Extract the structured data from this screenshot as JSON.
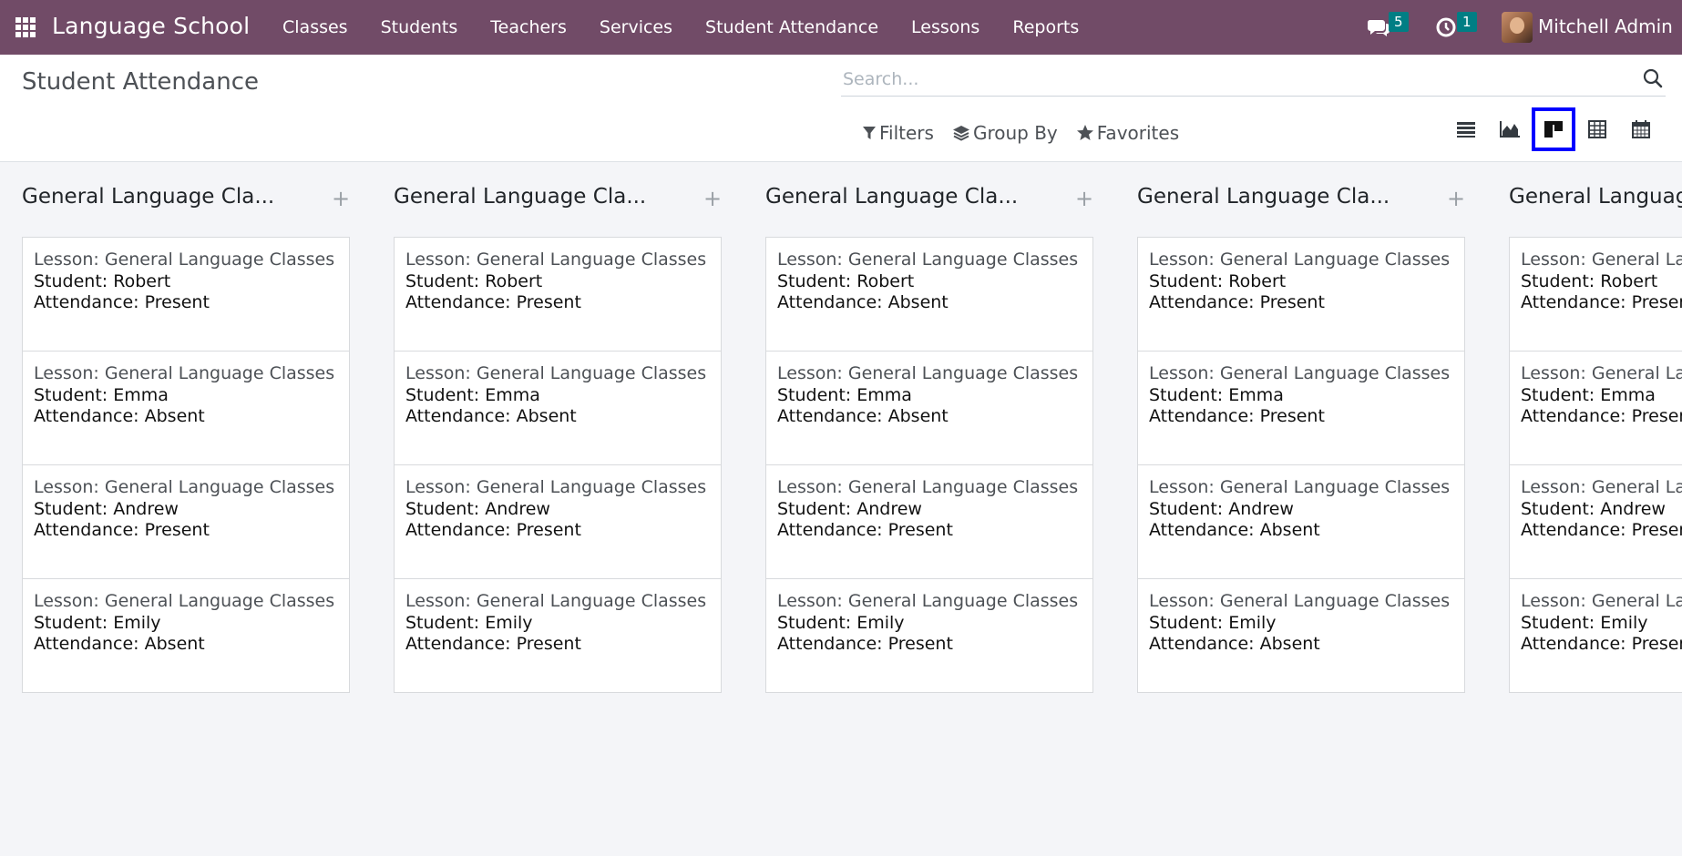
{
  "navbar": {
    "brand": "Language School",
    "menu": [
      "Classes",
      "Students",
      "Teachers",
      "Services",
      "Student Attendance",
      "Lessons",
      "Reports"
    ],
    "messages_count": "5",
    "activities_count": "1",
    "user": "Mitchell Admin"
  },
  "control_panel": {
    "title": "Student Attendance",
    "search_placeholder": "Search...",
    "filters_label": "Filters",
    "group_by_label": "Group By",
    "favorites_label": "Favorites",
    "views": [
      "list-view",
      "graph-view",
      "kanban-view",
      "pivot-view",
      "calendar-view"
    ],
    "active_view": "kanban-view"
  },
  "kanban": {
    "columns": [
      {
        "title": "General Language Cla...",
        "cards": [
          {
            "lesson": "Lesson: General Language Classes",
            "student": "Student: Robert",
            "attendance": "Attendance: Present"
          },
          {
            "lesson": "Lesson: General Language Classes",
            "student": "Student: Emma",
            "attendance": "Attendance: Absent"
          },
          {
            "lesson": "Lesson: General Language Classes",
            "student": "Student: Andrew",
            "attendance": "Attendance: Present"
          },
          {
            "lesson": "Lesson: General Language Classes",
            "student": "Student: Emily",
            "attendance": "Attendance: Absent"
          }
        ]
      },
      {
        "title": "General Language Cla...",
        "cards": [
          {
            "lesson": "Lesson: General Language Classes",
            "student": "Student: Robert",
            "attendance": "Attendance: Present"
          },
          {
            "lesson": "Lesson: General Language Classes",
            "student": "Student: Emma",
            "attendance": "Attendance: Absent"
          },
          {
            "lesson": "Lesson: General Language Classes",
            "student": "Student: Andrew",
            "attendance": "Attendance: Present"
          },
          {
            "lesson": "Lesson: General Language Classes",
            "student": "Student: Emily",
            "attendance": "Attendance: Present"
          }
        ]
      },
      {
        "title": "General Language Cla...",
        "cards": [
          {
            "lesson": "Lesson: General Language Classes",
            "student": "Student: Robert",
            "attendance": "Attendance: Absent"
          },
          {
            "lesson": "Lesson: General Language Classes",
            "student": "Student: Emma",
            "attendance": "Attendance: Absent"
          },
          {
            "lesson": "Lesson: General Language Classes",
            "student": "Student: Andrew",
            "attendance": "Attendance: Present"
          },
          {
            "lesson": "Lesson: General Language Classes",
            "student": "Student: Emily",
            "attendance": "Attendance: Present"
          }
        ]
      },
      {
        "title": "General Language Cla...",
        "cards": [
          {
            "lesson": "Lesson: General Language Classes",
            "student": "Student: Robert",
            "attendance": "Attendance: Present"
          },
          {
            "lesson": "Lesson: General Language Classes",
            "student": "Student: Emma",
            "attendance": "Attendance: Present"
          },
          {
            "lesson": "Lesson: General Language Classes",
            "student": "Student: Andrew",
            "attendance": "Attendance: Absent"
          },
          {
            "lesson": "Lesson: General Language Classes",
            "student": "Student: Emily",
            "attendance": "Attendance: Absent"
          }
        ]
      },
      {
        "title": "General Language Cla...",
        "cards": [
          {
            "lesson": "Lesson: General Language Classes",
            "student": "Student: Robert",
            "attendance": "Attendance: Present"
          },
          {
            "lesson": "Lesson: General Language Classes",
            "student": "Student: Emma",
            "attendance": "Attendance: Present"
          },
          {
            "lesson": "Lesson: General Language Classes",
            "student": "Student: Andrew",
            "attendance": "Attendance: Present"
          },
          {
            "lesson": "Lesson: General Language Classes",
            "student": "Student: Emily",
            "attendance": "Attendance: Present"
          }
        ]
      }
    ]
  }
}
